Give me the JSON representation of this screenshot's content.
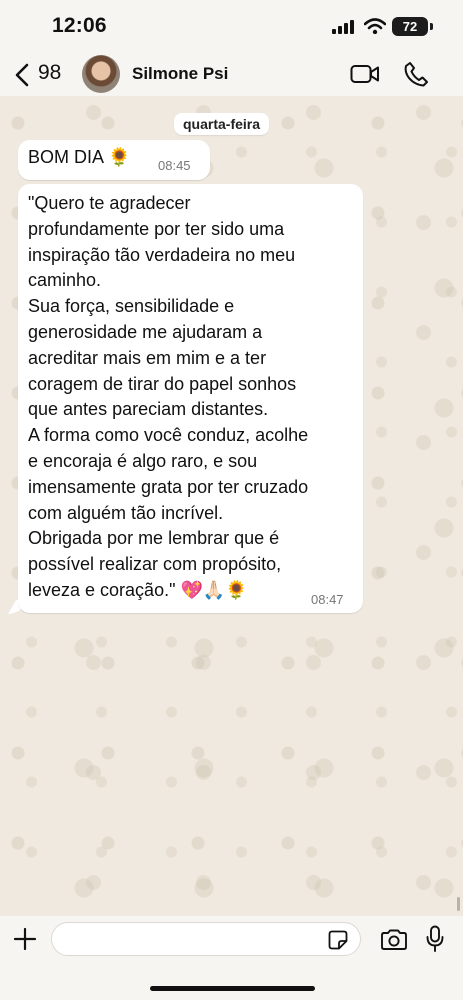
{
  "status_bar": {
    "time": "12:06",
    "battery_level": "72"
  },
  "header": {
    "back_count": "98",
    "contact_name": "Silmone Psi"
  },
  "day_separator": "quarta-feira",
  "messages": [
    {
      "text": "BOM DIA 🌻",
      "time": "08:45"
    },
    {
      "text": "\"Quero te agradecer\nprofundamente por ter sido uma\ninspiração tão verdadeira no meu\ncaminho.\nSua força, sensibilidade e\ngenerosidade me ajudaram a\nacreditar mais em mim e a ter\ncoragem de tirar do papel sonhos\nque antes pareciam distantes.\nA forma como você conduz, acolhe\ne encoraja é algo raro, e sou\nimensamente grata por ter cruzado\ncom alguém tão incrível.\nObrigada por me lembrar que é\npossível realizar com propósito,\nleveza e coração.\" 💖🙏🏻🌻",
      "time": "08:47"
    }
  ],
  "composer": {
    "value": "",
    "placeholder": ""
  },
  "icons": {
    "back": "chevron-left-icon",
    "video": "video-camera-icon",
    "phone": "phone-icon",
    "plus": "plus-icon",
    "sticker": "sticker-icon",
    "camera": "camera-icon",
    "mic": "microphone-icon"
  },
  "colors": {
    "chat_background": "#efe9df",
    "bubble_incoming": "#ffffff",
    "timestamp": "#777777"
  }
}
